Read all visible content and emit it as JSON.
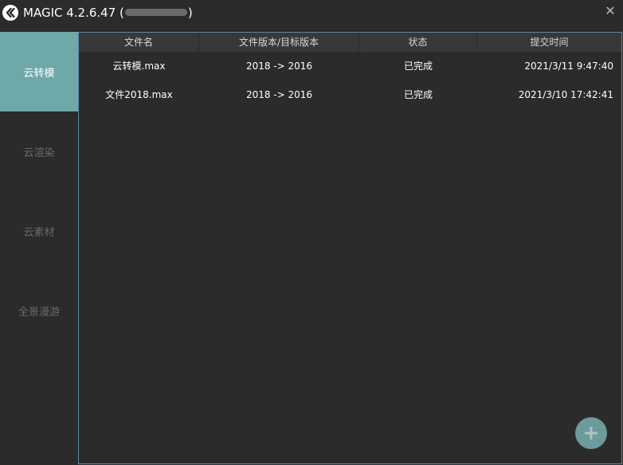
{
  "titlebar": {
    "app_name": "MAGIC 4.2.6.47",
    "paren_open": "(",
    "paren_close": ")",
    "close_glyph": "✕"
  },
  "sidebar": {
    "items": [
      {
        "label": "云转模",
        "active": true
      },
      {
        "label": "云渲染",
        "active": false
      },
      {
        "label": "云素材",
        "active": false
      },
      {
        "label": "全景漫游",
        "active": false
      }
    ]
  },
  "table": {
    "headers": {
      "name": "文件名",
      "version": "文件版本/目标版本",
      "status": "状态",
      "time": "提交时间"
    },
    "rows": [
      {
        "name": "云转模.max",
        "version": "2018 -> 2016",
        "status": "已完成",
        "time": "2021/3/11 9:47:40"
      },
      {
        "name": "文件2018.max",
        "version": "2018 -> 2016",
        "status": "已完成",
        "time": "2021/3/10 17:42:41"
      }
    ]
  },
  "icons": {
    "logo": "app-logo-icon",
    "close": "close-icon",
    "add": "plus-icon"
  },
  "colors": {
    "background": "#2b2b2b",
    "accent": "#6fa8a8",
    "header_bg": "#383838",
    "panel_border": "#5c87a8",
    "add_button": "#6d9a9a",
    "inactive_text": "#6a6a6a"
  }
}
